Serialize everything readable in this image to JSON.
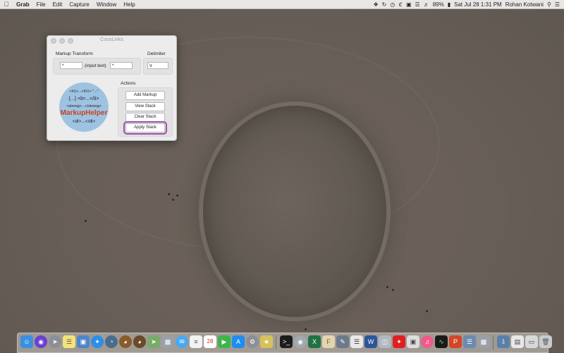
{
  "menubar": {
    "app": "Grab",
    "items": [
      "File",
      "Edit",
      "Capture",
      "Window",
      "Help"
    ],
    "battery": "89%",
    "datetime": "Sat Jul 28  1:31 PM",
    "user": "Rohan Kotwani"
  },
  "window": {
    "title": "CocoLinks",
    "markup_transform_label": "Markup Transform",
    "prefix_value": "*",
    "input_text_label": "(input text)",
    "suffix_value": "*",
    "delimiter_label": "Delimiter",
    "delimiter_value": "\\r",
    "actions_label": "Actions",
    "buttons": {
      "add_markup": "Add Markup",
      "view_stack": "View Stack",
      "clear_stack": "Clear Stack",
      "apply_stack": "Apply Stack"
    },
    "logo": {
      "line1": "<h1>...</h1>  \"...\"",
      "line2": "{...}  <li>...</li>",
      "line3": "<strong>...</strong>",
      "line4": "MarkupHelper",
      "line5": "<dl>...</dl>"
    }
  },
  "dock": {
    "icons": [
      "finder-icon",
      "siri-icon",
      "launchpad-icon",
      "notes-icon",
      "preview-icon",
      "safari-icon",
      "app-icon",
      "app-icon",
      "app-icon",
      "maps-icon",
      "app-icon",
      "messages-icon",
      "reminders-icon",
      "calendar-icon",
      "facetime-icon",
      "app-store-icon",
      "system-preferences-icon",
      "app-icon",
      "terminal-icon",
      "app-icon",
      "excel-icon",
      "app-icon",
      "app-icon",
      "app-icon",
      "word-icon",
      "app-icon",
      "acrobat-icon",
      "app-icon",
      "itunes-icon",
      "activity-monitor-icon",
      "powerpoint-icon",
      "app-icon",
      "app-icon",
      "downloads-icon",
      "documents-icon",
      "trash-icon"
    ],
    "calendar_day": "28"
  }
}
